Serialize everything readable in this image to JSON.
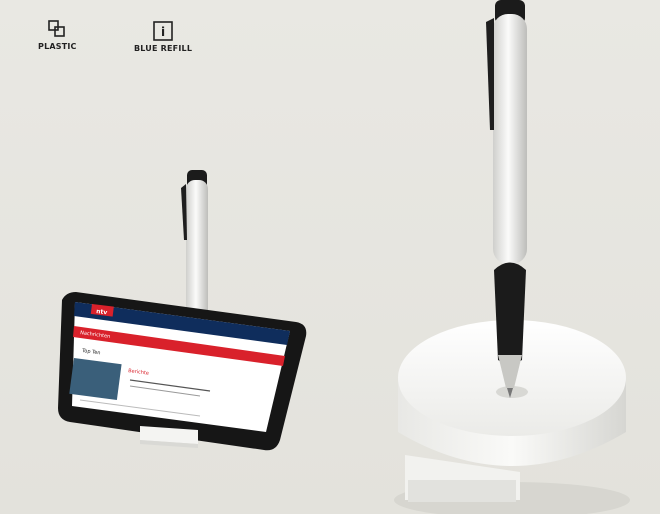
{
  "features": {
    "material_label": "PLASTIC",
    "material_icon": "plastic-material-icon",
    "refill_label": "BLUE REFILL",
    "refill_icon": "info-i-icon",
    "refill_icon_glyph": "i"
  },
  "phone_screen": {
    "site_logo_text": "ntv",
    "banner_text": "Nachrichten",
    "headline_1": "Top Ten",
    "headline_2": "Berichte"
  },
  "colors": {
    "background": "#e6e5e0",
    "accent_red": "#d9212b",
    "holder_white": "#f4f4f2",
    "pen_black": "#1b1b1b"
  }
}
